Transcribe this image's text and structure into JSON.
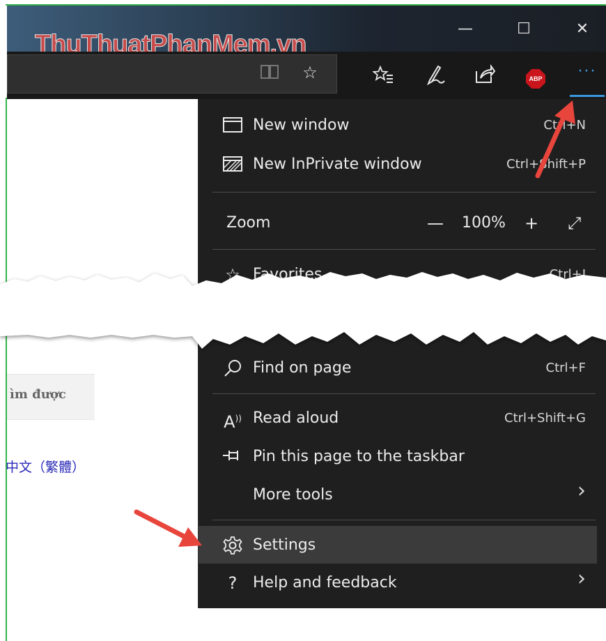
{
  "watermark": "ThuThuatPhanMem.vn",
  "window_controls": {
    "minimize": "—",
    "maximize": "☐",
    "close": "✕"
  },
  "toolbar": {
    "icons": [
      "reading-view-icon",
      "star-icon",
      "favorites-list-icon",
      "pen-icon",
      "share-icon",
      "adblock-icon",
      "more-icon"
    ],
    "abp_label": "ABP",
    "more_label": "···"
  },
  "page": {
    "button_text": "ìm được",
    "link_text": "中文（繁體）"
  },
  "menu": {
    "new_window": {
      "label": "New window",
      "shortcut": "Ctrl+N"
    },
    "new_inprivate": {
      "label": "New InPrivate window",
      "shortcut": "Ctrl+Shift+P"
    },
    "zoom": {
      "label": "Zoom",
      "minus": "—",
      "value": "100%",
      "plus": "+",
      "fullscreen": "⤢"
    },
    "favorites": {
      "label": "Favorites",
      "shortcut": "Ctrl+I"
    },
    "find": {
      "label": "Find on page",
      "shortcut": "Ctrl+F"
    },
    "read_aloud": {
      "label": "Read aloud",
      "shortcut": "Ctrl+Shift+G"
    },
    "pin": {
      "label": "Pin this page to the taskbar"
    },
    "more_tools": {
      "label": "More tools",
      "chevron": "›"
    },
    "settings": {
      "label": "Settings"
    },
    "help": {
      "label": "Help and feedback",
      "chevron": "›"
    }
  },
  "colors": {
    "accent": "#3a96dd",
    "menu_bg": "#1f1f1f",
    "arrow": "#e8453c",
    "border": "#34b34a"
  }
}
